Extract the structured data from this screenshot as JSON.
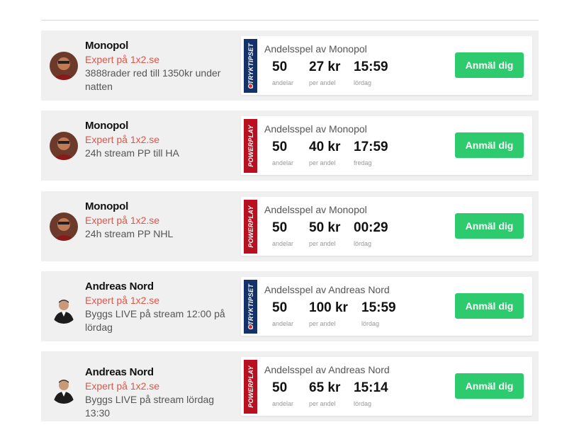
{
  "rows": [
    {
      "name": "Monopol",
      "role": "Expert på 1x2.se",
      "desc": "3888rader red till 1350kr under natten",
      "game": "STRYKTIPSET",
      "game_type": "stryk",
      "title": "Andelsspel av Monopol",
      "stats": [
        {
          "value": "50",
          "label": "andelar"
        },
        {
          "value": "27 kr",
          "label": "per andel"
        },
        {
          "value": "15:59",
          "label": "lördag"
        }
      ],
      "button": "Anmäl dig"
    },
    {
      "name": "Monopol",
      "role": "Expert på 1x2.se",
      "desc": "24h stream PP till HA",
      "game": "POWERPLAY",
      "game_type": "power",
      "title": "Andelsspel av Monopol",
      "stats": [
        {
          "value": "50",
          "label": "andelar"
        },
        {
          "value": "40 kr",
          "label": "per andel"
        },
        {
          "value": "17:59",
          "label": "fredag"
        }
      ],
      "button": "Anmäl dig"
    },
    {
      "name": "Monopol",
      "role": "Expert på 1x2.se",
      "desc": "24h stream PP NHL",
      "game": "POWERPLAY",
      "game_type": "power",
      "title": "Andelsspel av Monopol",
      "stats": [
        {
          "value": "50",
          "label": "andelar"
        },
        {
          "value": "50 kr",
          "label": "per andel"
        },
        {
          "value": "00:29",
          "label": "lördag"
        }
      ],
      "button": "Anmäl dig"
    },
    {
      "name": "Andreas Nord",
      "role": "Expert på 1x2.se",
      "desc": "Byggs LIVE på stream 12:00 på lördag",
      "game": "STRYKTIPSET",
      "game_type": "stryk",
      "title": "Andelsspel av Andreas Nord",
      "stats": [
        {
          "value": "50",
          "label": "andelar"
        },
        {
          "value": "100 kr",
          "label": "per andel"
        },
        {
          "value": "15:59",
          "label": "lördag"
        }
      ],
      "button": "Anmäl dig"
    },
    {
      "name": "Andreas Nord",
      "role": "Expert på 1x2.se",
      "desc": "Byggs LIVE på stream lördag 13:30",
      "game": "POWERPLAY",
      "game_type": "power",
      "title": "Andelsspel av Andreas Nord",
      "stats": [
        {
          "value": "50",
          "label": "andelar"
        },
        {
          "value": "65 kr",
          "label": "per andel"
        },
        {
          "value": "15:14",
          "label": "lördag"
        }
      ],
      "button": "Anmäl dig"
    }
  ]
}
